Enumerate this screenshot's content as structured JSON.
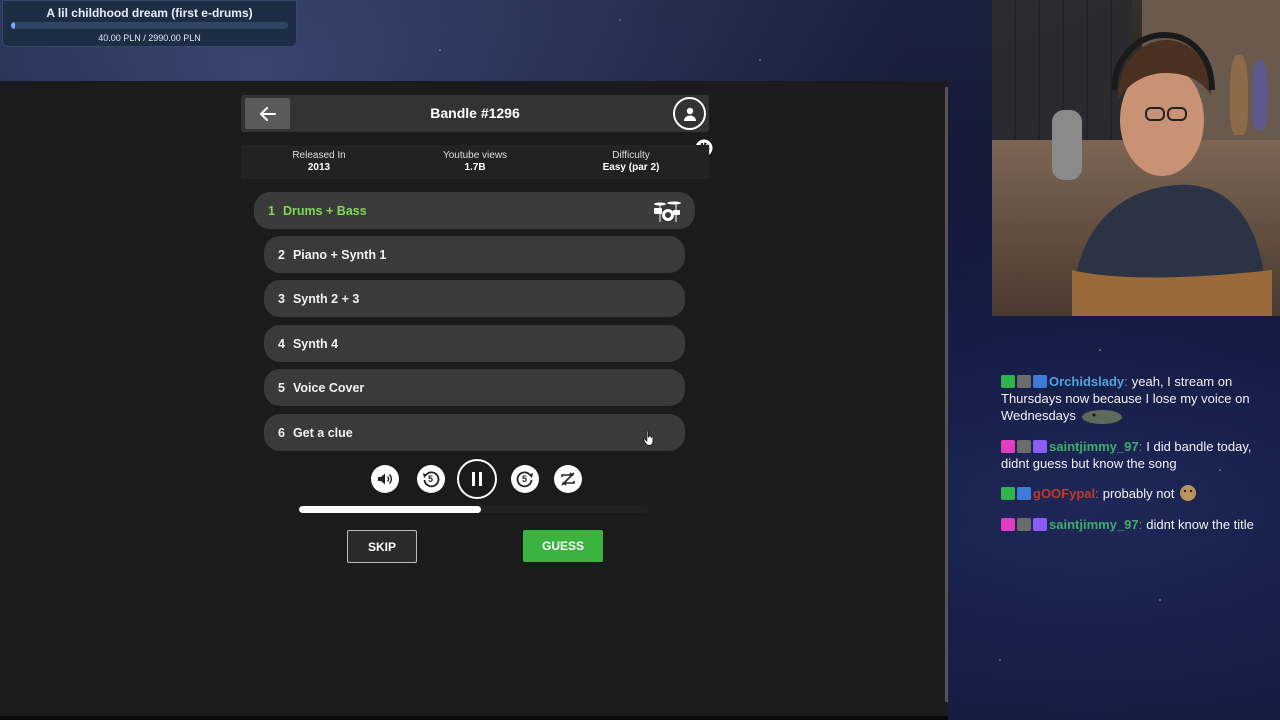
{
  "goal": {
    "title": "A lil childhood dream (first e-drums)",
    "amount": "40.00 PLN / 2990.00 PLN",
    "progress": 0.013,
    "color": "#6fa8ff"
  },
  "game": {
    "title": "Bandle #1296",
    "info": [
      {
        "label": "Released In",
        "value": "2013"
      },
      {
        "label": "Youtube views",
        "value": "1.7B"
      },
      {
        "label": "Difficulty",
        "value": "Easy (par 2)"
      }
    ],
    "stems": [
      {
        "num": "1",
        "label": "Drums + Bass",
        "active": true
      },
      {
        "num": "2",
        "label": "Piano + Synth 1"
      },
      {
        "num": "3",
        "label": "Synth 2 + 3"
      },
      {
        "num": "4",
        "label": "Synth 4"
      },
      {
        "num": "5",
        "label": "Voice Cover"
      },
      {
        "num": "6",
        "label": "Get a clue"
      }
    ],
    "controls": {
      "rewind_seconds": "5",
      "forward_seconds": "5",
      "playback_progress": 0.52
    },
    "skip_label": "SKIP",
    "guess_label": "GUESS",
    "accent_color": "#7ed957",
    "guess_color": "#3ab43e"
  },
  "chat": [
    {
      "user": "Orchidslady",
      "color": "#4fa3e0",
      "text": "yeah, I stream on Thursdays now because I lose my voice on Wednesdays",
      "badges": [
        "check",
        "photo",
        "verified"
      ],
      "emote": "lizard"
    },
    {
      "user": "saintjimmy_97",
      "color": "#3fae6a",
      "text": "I did bandle today, didnt guess but know the song",
      "badges": [
        "gem",
        "photo",
        "sub"
      ]
    },
    {
      "user": "gOOFypal",
      "color": "#c0392b",
      "text": "probably not",
      "badges": [
        "check",
        "verified"
      ],
      "emote": "bear"
    },
    {
      "user": "saintjimmy_97",
      "color": "#3fae6a",
      "text": "didnt know the title",
      "badges": [
        "gem",
        "photo",
        "sub"
      ]
    }
  ]
}
